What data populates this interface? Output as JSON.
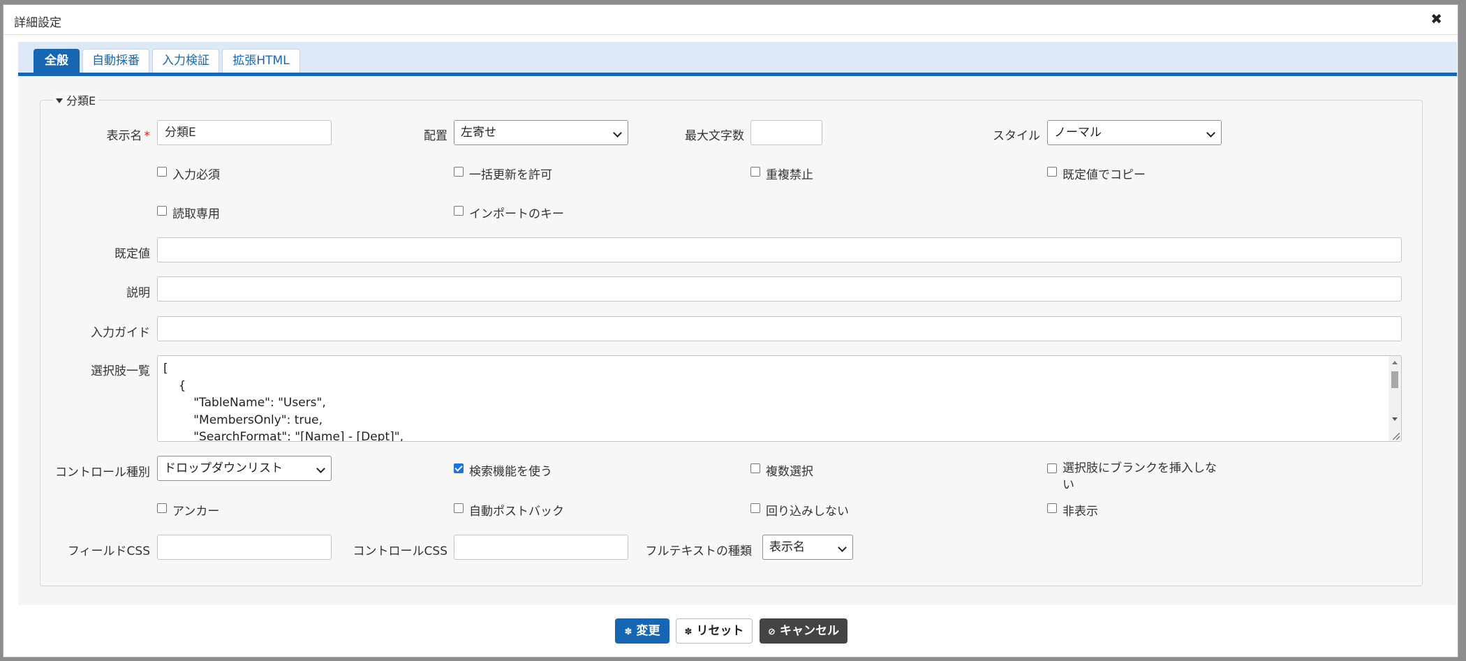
{
  "dialog": {
    "title": "詳細設定",
    "close_symbol": "✖"
  },
  "tabs": [
    {
      "label": "全般",
      "active": true
    },
    {
      "label": "自動採番",
      "active": false
    },
    {
      "label": "入力検証",
      "active": false
    },
    {
      "label": "拡張HTML",
      "active": false
    }
  ],
  "section": {
    "legend": "分類E"
  },
  "fields": {
    "display_name": {
      "label": "表示名",
      "required_mark": "*",
      "value": "分類E"
    },
    "alignment": {
      "label": "配置",
      "value": "左寄せ"
    },
    "max_length": {
      "label": "最大文字数",
      "value": ""
    },
    "style": {
      "label": "スタイル",
      "value": "ノーマル"
    },
    "default_value": {
      "label": "既定値",
      "value": ""
    },
    "description": {
      "label": "説明",
      "value": ""
    },
    "input_guide": {
      "label": "入力ガイド",
      "value": ""
    },
    "choices": {
      "label": "選択肢一覧",
      "value": "[\n    {\n        \"TableName\": \"Users\",\n        \"MembersOnly\": true,\n        \"SearchFormat\": \"[Name] - [Dept]\","
    },
    "control_type": {
      "label": "コントロール種別",
      "value": "ドロップダウンリスト"
    },
    "field_css": {
      "label": "フィールドCSS",
      "value": ""
    },
    "control_css": {
      "label": "コントロールCSS",
      "value": ""
    },
    "fulltext_type": {
      "label": "フルテキストの種類",
      "value": "表示名"
    }
  },
  "checkboxes": {
    "required": {
      "label": "入力必須",
      "checked": false
    },
    "allow_bulk_update": {
      "label": "一括更新を許可",
      "checked": false
    },
    "no_duplicates": {
      "label": "重複禁止",
      "checked": false
    },
    "copy_by_default": {
      "label": "既定値でコピー",
      "checked": false
    },
    "read_only": {
      "label": "読取専用",
      "checked": false
    },
    "import_key": {
      "label": "インポートのキー",
      "checked": false
    },
    "use_search": {
      "label": "検索機能を使う",
      "checked": true
    },
    "multiple_selection": {
      "label": "複数選択",
      "checked": false
    },
    "no_blank_line1": {
      "label": "選択肢にブランクを挿入しな",
      "checked": false
    },
    "no_blank_line2": "い",
    "anchor": {
      "label": "アンカー",
      "checked": false
    },
    "auto_postback": {
      "label": "自動ポストバック",
      "checked": false
    },
    "no_wrap": {
      "label": "回り込みしない",
      "checked": false
    },
    "hidden": {
      "label": "非表示",
      "checked": false
    }
  },
  "buttons": {
    "change": {
      "label": "変更",
      "icon": "gear-icon",
      "icon_glyph": "✽"
    },
    "reset": {
      "label": "リセット",
      "icon": "gear-icon",
      "icon_glyph": "✽"
    },
    "cancel": {
      "label": "キャンセル",
      "icon": "ban-icon",
      "icon_glyph": "⊘"
    }
  },
  "colors": {
    "primary": "#1766b4",
    "tabbar_bg": "#dde9f6",
    "required": "#d8202c",
    "dark_button": "#444444"
  }
}
